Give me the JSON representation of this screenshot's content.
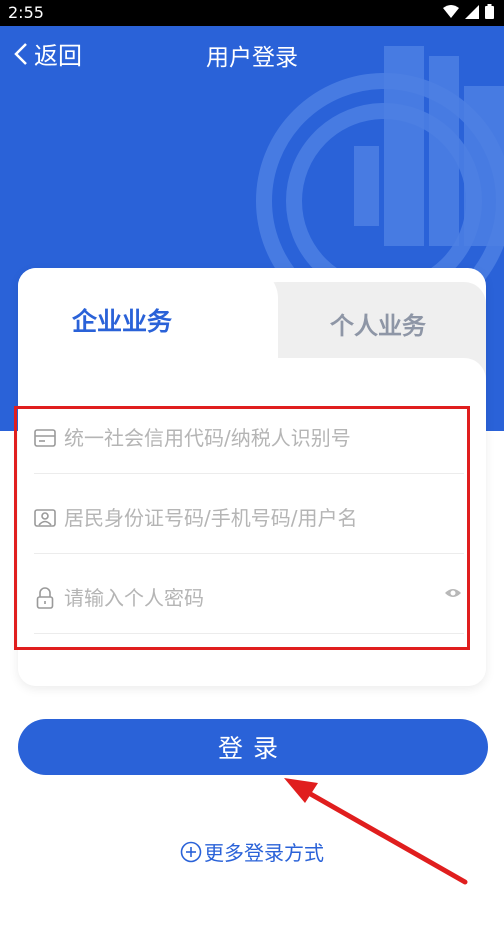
{
  "status_bar": {
    "time": "2:55",
    "wifi_icon": "wifi-icon",
    "signal_icon": "signal-icon",
    "battery_icon": "battery-icon"
  },
  "header": {
    "back_label": "返回",
    "title": "用户登录",
    "emblem_icon": "tax-bureau-emblem-icon"
  },
  "tabs": [
    {
      "label": "企业业务",
      "active": true
    },
    {
      "label": "个人业务",
      "active": false
    }
  ],
  "form": {
    "credit_code": {
      "placeholder": "统一社会信用代码/纳税人识别号",
      "icon": "id-card-icon"
    },
    "id_number": {
      "placeholder": "居民身份证号码/手机号码/用户名",
      "icon": "person-card-icon"
    },
    "password": {
      "placeholder": "请输入个人密码",
      "icon": "lock-icon",
      "toggle_icon": "eye-icon"
    }
  },
  "login_button": "登录",
  "more_login": "更多登录方式",
  "colors": {
    "brand": "#2a62d8",
    "highlight": "#e01e1e"
  }
}
